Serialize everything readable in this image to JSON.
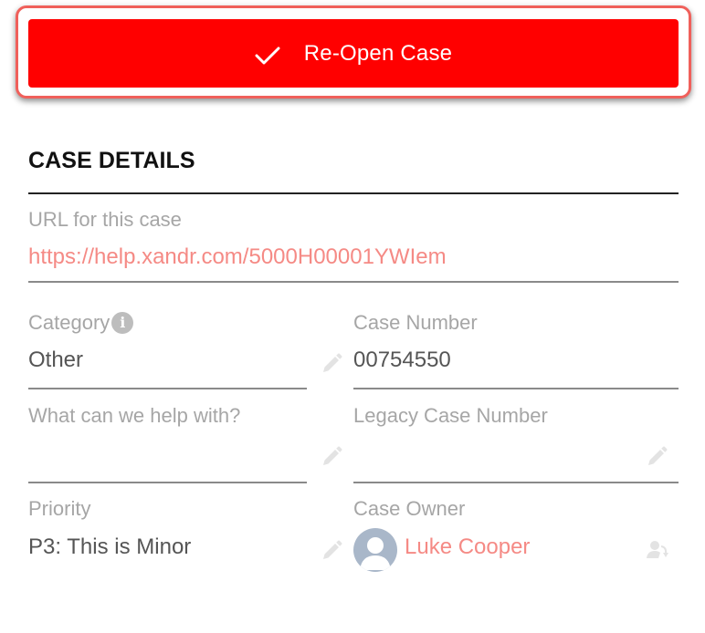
{
  "actions": {
    "reopen_label": "Re-Open Case",
    "reopen_icon": "check-icon"
  },
  "section": {
    "title": "CASE DETAILS"
  },
  "url_field": {
    "label": "URL for this case",
    "value": "https://help.xandr.com/5000H00001YWIem"
  },
  "fields": {
    "category": {
      "label": "Category",
      "value": "Other"
    },
    "case_number": {
      "label": "Case Number",
      "value": "00754550"
    },
    "help_with": {
      "label": "What can we help with?",
      "value": ""
    },
    "legacy_case_number": {
      "label": "Legacy Case Number",
      "value": ""
    },
    "priority": {
      "label": "Priority",
      "value": "P3: This is Minor"
    },
    "case_owner": {
      "label": "Case Owner",
      "value": "Luke Cooper"
    }
  },
  "colors": {
    "button_bg": "#ff0000",
    "highlight_ring": "#f0605b",
    "link": "#f58a85",
    "label": "#a6a6a6"
  }
}
